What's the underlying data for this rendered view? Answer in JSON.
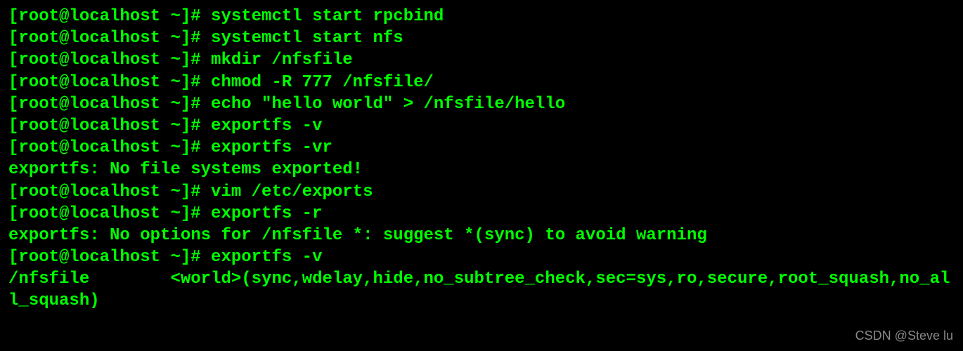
{
  "terminal": {
    "lines": [
      {
        "prompt": "[root@localhost ~]# ",
        "command": "systemctl start rpcbind"
      },
      {
        "prompt": "[root@localhost ~]# ",
        "command": "systemctl start nfs"
      },
      {
        "prompt": "[root@localhost ~]# ",
        "command": "mkdir /nfsfile"
      },
      {
        "prompt": "[root@localhost ~]# ",
        "command": "chmod -R 777 /nfsfile/"
      },
      {
        "prompt": "[root@localhost ~]# ",
        "command": "echo \"hello world\" > /nfsfile/hello"
      },
      {
        "prompt": "[root@localhost ~]# ",
        "command": "exportfs -v"
      },
      {
        "prompt": "[root@localhost ~]# ",
        "command": "exportfs -vr"
      },
      {
        "output": "exportfs: No file systems exported!"
      },
      {
        "prompt": "[root@localhost ~]# ",
        "command": "vim /etc/exports"
      },
      {
        "prompt": "[root@localhost ~]# ",
        "command": "exportfs -r"
      },
      {
        "output": "exportfs: No options for /nfsfile *: suggest *(sync) to avoid warning"
      },
      {
        "prompt": "[root@localhost ~]# ",
        "command": "exportfs -v"
      },
      {
        "output": "/nfsfile      \t<world>(sync,wdelay,hide,no_subtree_check,sec=sys,ro,secure,root_squash,no_all_squash)"
      }
    ]
  },
  "watermark": "CSDN @Steve lu"
}
